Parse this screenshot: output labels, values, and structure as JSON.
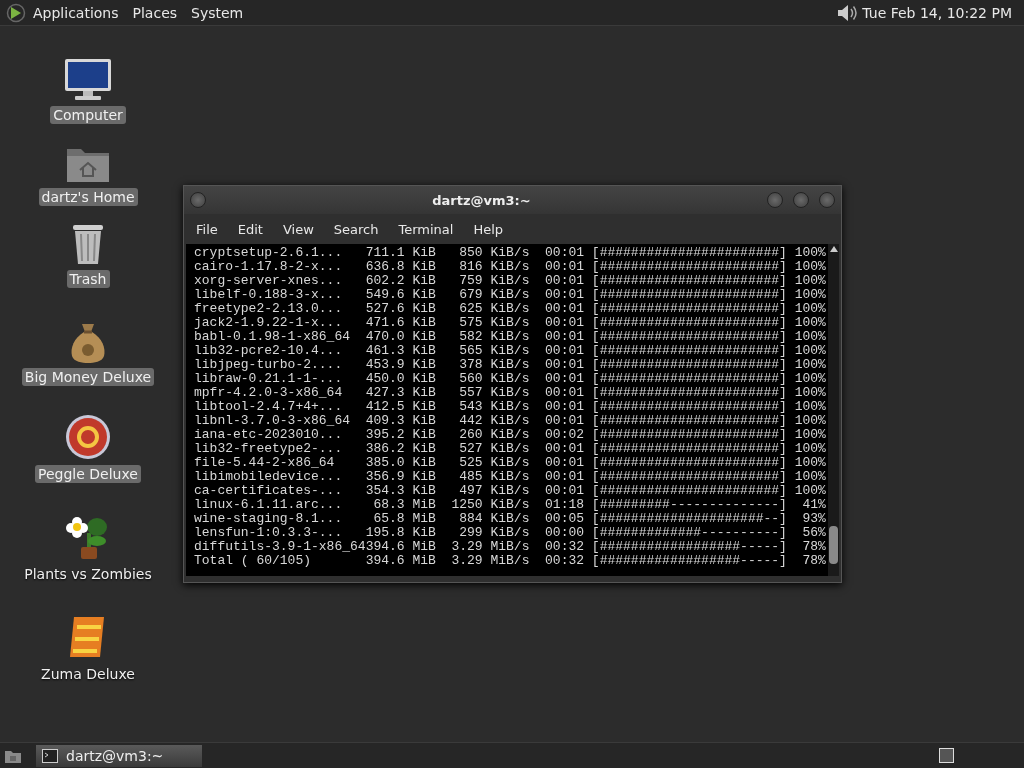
{
  "top_panel": {
    "menus": [
      {
        "label": "Applications"
      },
      {
        "label": "Places"
      },
      {
        "label": "System"
      }
    ],
    "clock": "Tue Feb 14, 10:22 PM"
  },
  "desktop_icons": [
    {
      "label": "Computer",
      "kind": "computer",
      "selected": true
    },
    {
      "label": "dartz's Home",
      "kind": "home",
      "selected": true
    },
    {
      "label": "Trash",
      "kind": "trash",
      "selected": true
    },
    {
      "label": "Big Money Deluxe",
      "kind": "moneybag",
      "selected": true
    },
    {
      "label": "Peggle Deluxe",
      "kind": "ball",
      "selected": true
    },
    {
      "label": "Plants vs Zombies",
      "kind": "flower",
      "selected": false
    },
    {
      "label": "Zuma Deluxe",
      "kind": "block",
      "selected": false
    }
  ],
  "terminal": {
    "title": "dartz@vm3:~",
    "menus": [
      "File",
      "Edit",
      "View",
      "Search",
      "Terminal",
      "Help"
    ],
    "lines": [
      "cryptsetup-2.6.1...   711.1 KiB   850 KiB/s  00:01 [#######################] 100%",
      "cairo-1.17.8-2-x...   636.8 KiB   816 KiB/s  00:01 [#######################] 100%",
      "xorg-server-xnes...   602.2 KiB   759 KiB/s  00:01 [#######################] 100%",
      "libelf-0.188-3-x...   549.6 KiB   679 KiB/s  00:01 [#######################] 100%",
      "freetype2-2.13.0...   527.6 KiB   625 KiB/s  00:01 [#######################] 100%",
      "jack2-1.9.22-1-x...   471.6 KiB   575 KiB/s  00:01 [#######################] 100%",
      "babl-0.1.98-1-x86_64  470.0 KiB   582 KiB/s  00:01 [#######################] 100%",
      "lib32-pcre2-10.4...   461.3 KiB   565 KiB/s  00:01 [#######################] 100%",
      "libjpeg-turbo-2....   453.9 KiB   378 KiB/s  00:01 [#######################] 100%",
      "libraw-0.21.1-1-...   450.0 KiB   560 KiB/s  00:01 [#######################] 100%",
      "mpfr-4.2.0-3-x86_64   427.3 KiB   557 KiB/s  00:01 [#######################] 100%",
      "libtool-2.4.7+4+...   412.5 KiB   543 KiB/s  00:01 [#######################] 100%",
      "libnl-3.7.0-3-x86_64  409.3 KiB   442 KiB/s  00:01 [#######################] 100%",
      "iana-etc-2023010...   395.2 KiB   260 KiB/s  00:02 [#######################] 100%",
      "lib32-freetype2-...   386.2 KiB   527 KiB/s  00:01 [#######################] 100%",
      "file-5.44-2-x86_64    385.0 KiB   525 KiB/s  00:01 [#######################] 100%",
      "libimobiledevice...   356.9 KiB   485 KiB/s  00:01 [#######################] 100%",
      "ca-certificates-...   354.3 KiB   497 KiB/s  00:01 [#######################] 100%",
      "linux-6.1.11.arc...    68.3 MiB  1250 KiB/s  01:18 [#########--------------]  41%",
      "wine-staging-8.1...    65.8 MiB   884 KiB/s  00:05 [#####################--]  93%",
      "lensfun-1:0.3.3-...   195.8 KiB   299 KiB/s  00:00 [#############----------]  56%",
      "diffutils-3.9-1-x86_64394.6 MiB  3.29 MiB/s  00:32 [##################-----]  78%",
      "Total ( 60/105)       394.6 MiB  3.29 MiB/s  00:32 [##################-----]  78%"
    ]
  },
  "taskbar": {
    "tasks": [
      {
        "label": "dartz@vm3:~",
        "selected": true
      }
    ]
  }
}
